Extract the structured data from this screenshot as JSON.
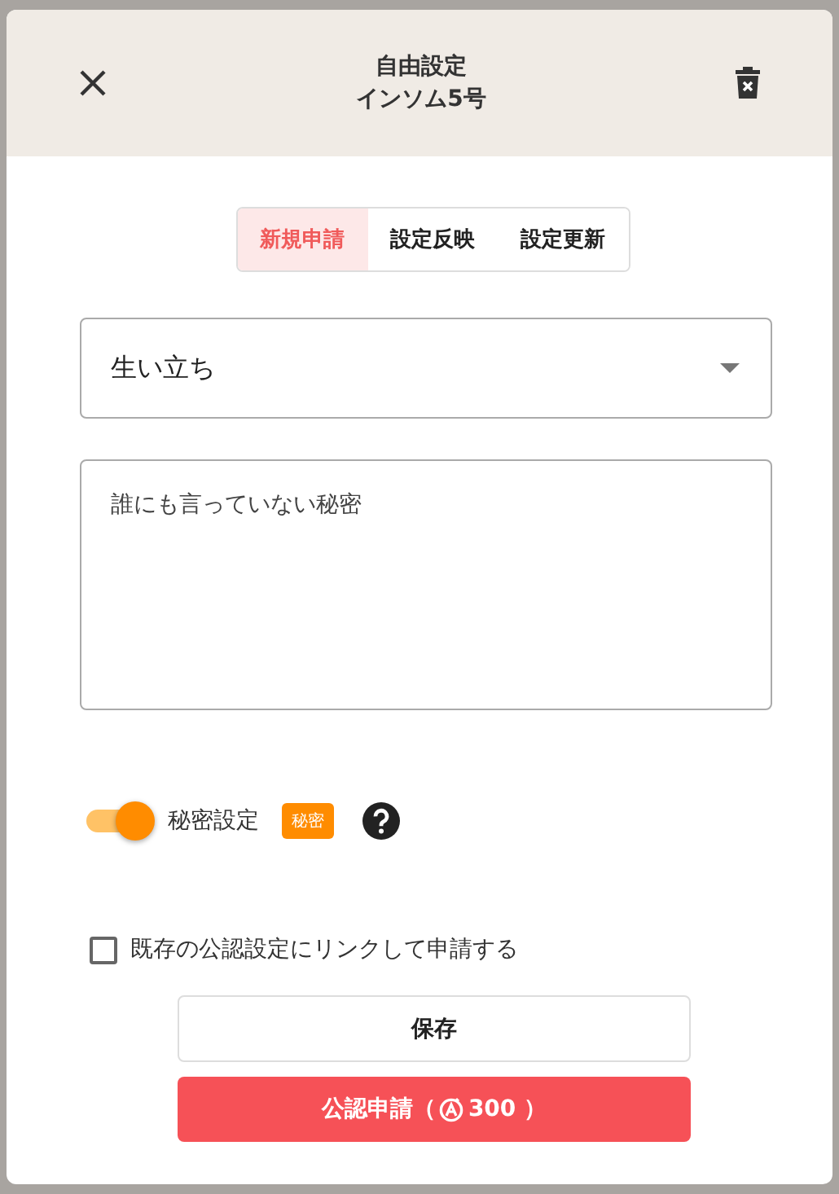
{
  "dialog": {
    "title": "自由設定",
    "subtitle": "インソム5号"
  },
  "tabs": [
    {
      "label": "新規申請",
      "selected": true
    },
    {
      "label": "設定反映",
      "selected": false
    },
    {
      "label": "設定更新",
      "selected": false
    }
  ],
  "select": {
    "value": "生い立ち"
  },
  "textarea": {
    "value": "誰にも言っていない秘密"
  },
  "secret": {
    "label": "秘密設定",
    "on": true,
    "badge": "秘密"
  },
  "link_option": {
    "label": "既存の公認設定にリンクして申請する",
    "checked": false
  },
  "save_button": {
    "label": "保存"
  },
  "submit_button": {
    "label": "公認申請（",
    "cost": "300 ）"
  }
}
